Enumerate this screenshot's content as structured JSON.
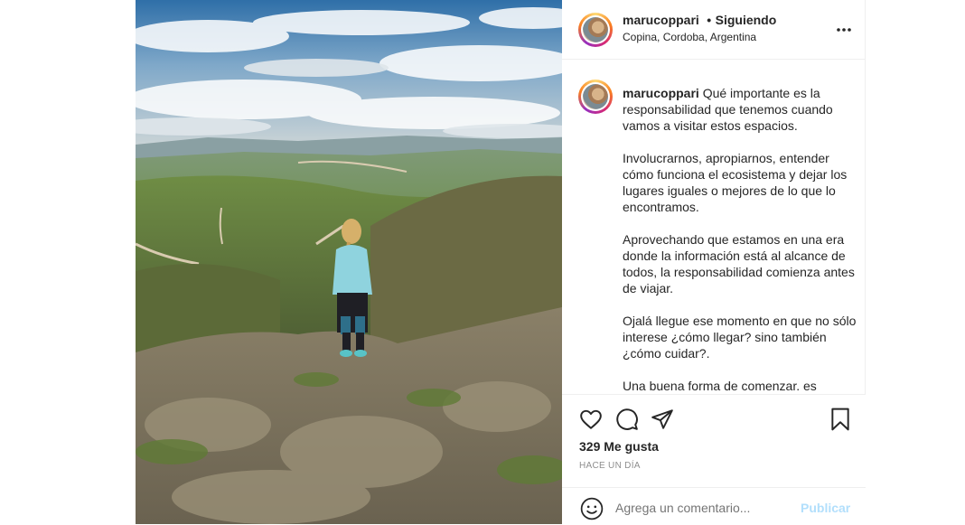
{
  "post": {
    "username": "marucoppari",
    "separator": "•",
    "follow_status": "Siguiendo",
    "location": "Copina, Cordoba, Argentina",
    "more_label": "•••"
  },
  "caption": {
    "username": "marucoppari",
    "paragraphs": [
      "Qué importante es la responsabilidad que tenemos cuando vamos a visitar estos espacios.",
      "Involucrarnos, apropiarnos, entender cómo funciona el ecosistema y dejar los lugares iguales o mejores de lo que lo encontramos.",
      "Aprovechando que estamos en una era donde la información está al alcance de todos, la responsabilidad comienza antes de viajar.",
      "Ojalá llegue ese momento en que no sólo interese ¿cómo llegar? sino también ¿cómo cuidar?.",
      "Una buena forma de comenzar. es"
    ]
  },
  "actions": {
    "icons": [
      "heart-icon",
      "comment-icon",
      "share-icon",
      "bookmark-icon"
    ],
    "likes": "329 Me gusta",
    "time": "HACE UN DÍA"
  },
  "comment": {
    "placeholder": "Agrega un comentario...",
    "emoji_icon": "smiley-icon",
    "publish_label": "Publicar"
  },
  "colors": {
    "publish_disabled": "#b2dffc",
    "text": "#262626",
    "muted": "#8e8e8e",
    "border": "#efefef"
  }
}
